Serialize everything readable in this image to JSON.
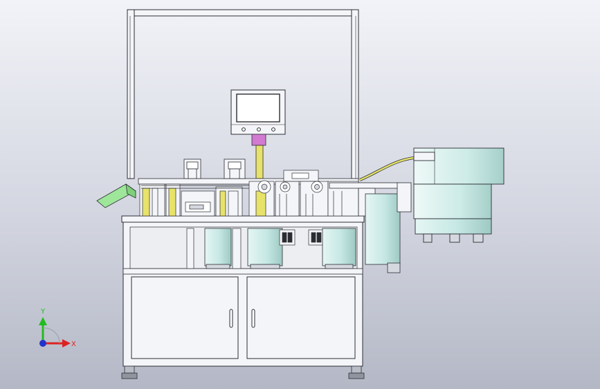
{
  "viewport": {
    "background_top": "#f2f3f8",
    "background_bottom": "#b4b8c6"
  },
  "colors": {
    "frame_fill": "#f4f5f8",
    "line": "#2a2d33",
    "motor_fill": "#c6e8e4",
    "accent_yellow": "#e7e26a",
    "accent_green": "#9ee69a",
    "accent_magenta": "#d27ad2",
    "axis_y": "#22bb22",
    "axis_x": "#dd2222",
    "axis_z": "#2233cc"
  },
  "triad": {
    "y_label": "Y",
    "x_label": "X"
  }
}
